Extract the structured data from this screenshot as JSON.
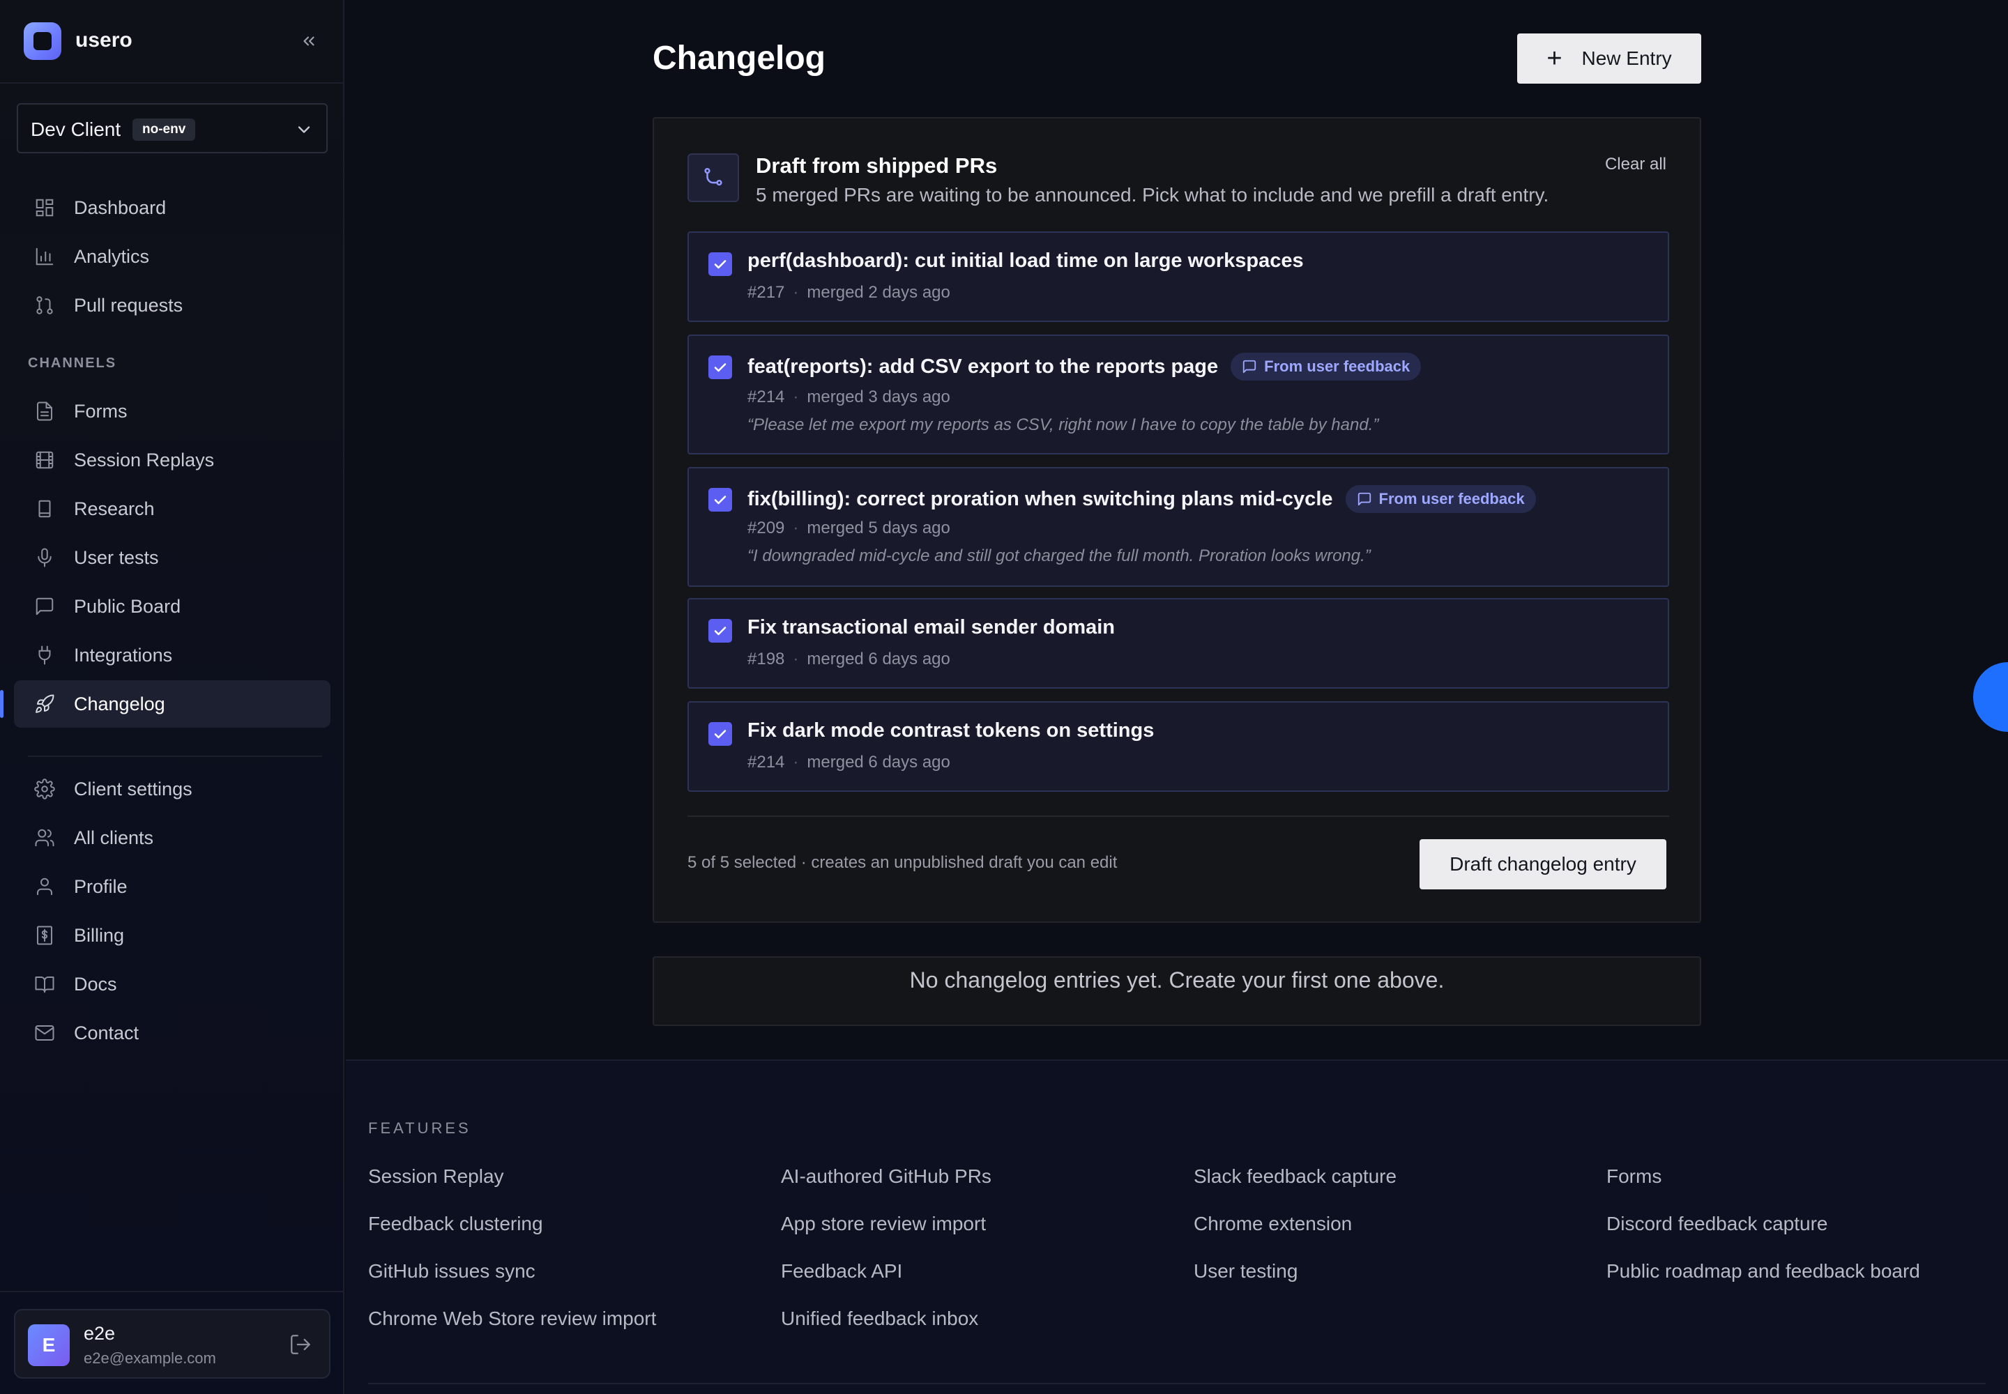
{
  "app": {
    "name": "usero"
  },
  "client": {
    "name": "Dev Client",
    "env": "no-env"
  },
  "nav": {
    "primary": [
      {
        "label": "Dashboard",
        "icon": "grid-icon"
      },
      {
        "label": "Analytics",
        "icon": "bar-chart-icon"
      },
      {
        "label": "Pull requests",
        "icon": "git-pull-request-icon"
      }
    ],
    "channels_heading": "CHANNELS",
    "channels": [
      {
        "label": "Forms",
        "icon": "document-icon"
      },
      {
        "label": "Session Replays",
        "icon": "film-icon"
      },
      {
        "label": "Research",
        "icon": "bookmark-icon"
      },
      {
        "label": "User tests",
        "icon": "microphone-icon"
      },
      {
        "label": "Public Board",
        "icon": "message-square-icon"
      },
      {
        "label": "Integrations",
        "icon": "plug-icon"
      },
      {
        "label": "Changelog",
        "icon": "rocket-icon",
        "active": true
      }
    ],
    "account": [
      {
        "label": "Client settings",
        "icon": "gear-icon"
      },
      {
        "label": "All clients",
        "icon": "users-icon"
      },
      {
        "label": "Profile",
        "icon": "user-icon"
      },
      {
        "label": "Billing",
        "icon": "dollar-icon"
      },
      {
        "label": "Docs",
        "icon": "book-icon"
      },
      {
        "label": "Contact",
        "icon": "mail-icon"
      }
    ]
  },
  "user": {
    "initial": "E",
    "name": "e2e",
    "email": "e2e@example.com"
  },
  "page": {
    "title": "Changelog",
    "new_entry_label": "New Entry"
  },
  "draft": {
    "title": "Draft from shipped PRs",
    "subtitle": "5 merged PRs are waiting to be announced. Pick what to include and we prefill a draft entry.",
    "clear_all": "Clear all",
    "prs": [
      {
        "title": "perf(dashboard): cut initial load time on large workspaces",
        "number": "#217",
        "merged": "merged 2 days ago",
        "checked": true
      },
      {
        "title": "feat(reports): add CSV export to the reports page",
        "number": "#214",
        "merged": "merged 3 days ago",
        "badge": "From user feedback",
        "quote": "“Please let me export my reports as CSV, right now I have to copy the table by hand.”",
        "checked": true
      },
      {
        "title": "fix(billing): correct proration when switching plans mid-cycle",
        "number": "#209",
        "merged": "merged 5 days ago",
        "badge": "From user feedback",
        "quote": "“I downgraded mid-cycle and still got charged the full month. Proration looks wrong.”",
        "checked": true
      },
      {
        "title": "Fix transactional email sender domain",
        "number": "#198",
        "merged": "merged 6 days ago",
        "checked": true
      },
      {
        "title": "Fix dark mode contrast tokens on settings",
        "number": "#214",
        "merged": "merged 6 days ago",
        "checked": true
      }
    ],
    "meta_separator": "·",
    "selection_note": "5 of 5 selected · creates an unpublished draft you can edit",
    "draft_button": "Draft changelog entry"
  },
  "empty_state": "No changelog entries yet. Create your first one above.",
  "footer": {
    "heading": "FEATURES",
    "columns": [
      [
        "Session Replay",
        "Feedback clustering",
        "GitHub issues sync",
        "Chrome Web Store review import"
      ],
      [
        "AI-authored GitHub PRs",
        "App store review import",
        "Feedback API",
        "Unified feedback inbox"
      ],
      [
        "Slack feedback capture",
        "Chrome extension",
        "User testing"
      ],
      [
        "Forms",
        "Discord feedback capture",
        "Public roadmap and feedback board"
      ]
    ]
  },
  "colors": {
    "accent": "#5b5ef0",
    "active_bar": "#4f7cff",
    "fab": "#1f6fff",
    "badge_text": "#9fa8ff"
  }
}
